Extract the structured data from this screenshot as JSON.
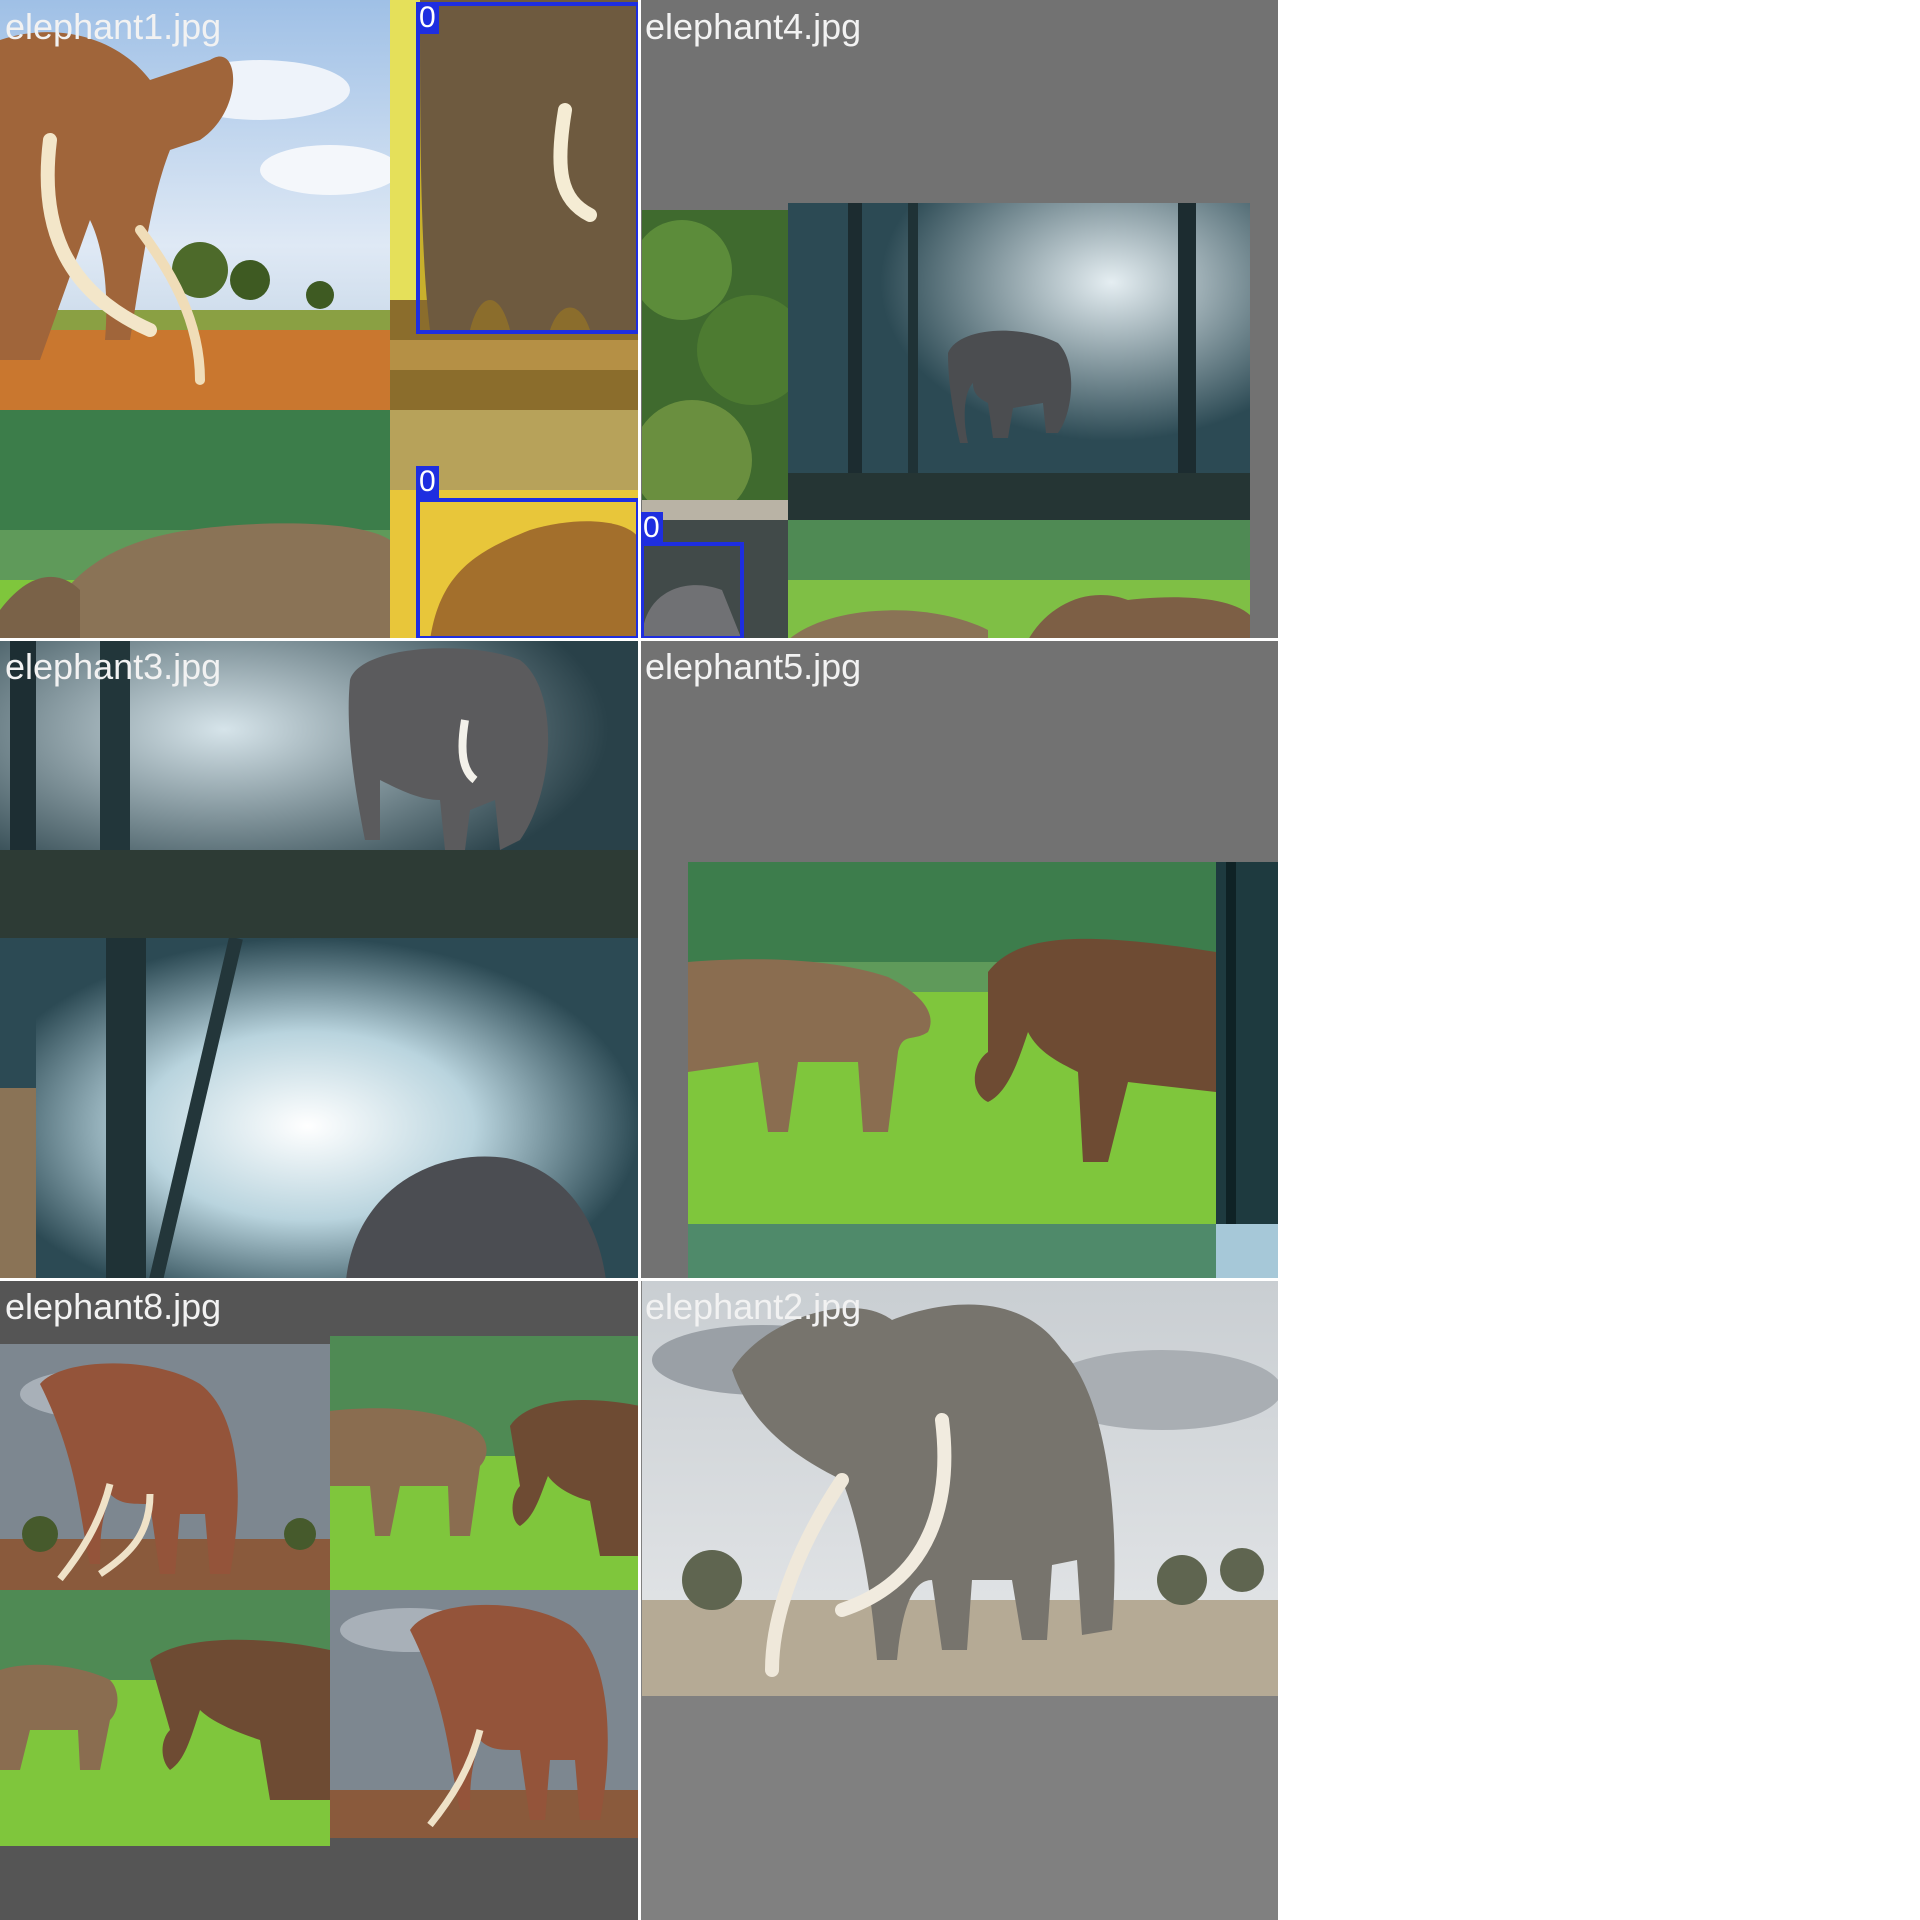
{
  "tiles": [
    {
      "label": "elephant1.jpg"
    },
    {
      "label": "elephant4.jpg"
    },
    {
      "label": "elephant3.jpg"
    },
    {
      "label": "elephant5.jpg"
    },
    {
      "label": "elephant8.jpg"
    },
    {
      "label": "elephant2.jpg"
    }
  ],
  "boxes": [
    {
      "class_id": "0"
    },
    {
      "class_id": "0"
    },
    {
      "class_id": "0"
    }
  ],
  "colors": {
    "box": "#1e2ee0",
    "letterbox_gray": "#727272",
    "label_text": "#f2f2f2"
  }
}
